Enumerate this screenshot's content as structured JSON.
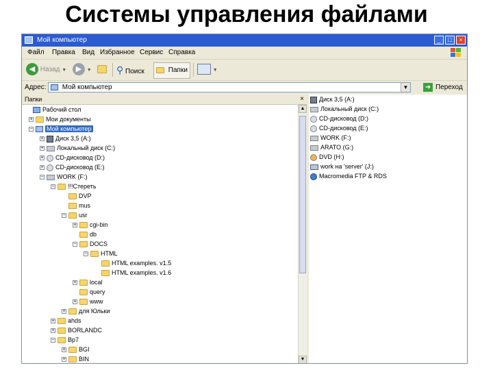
{
  "slide_title": "Системы управления файлами",
  "window": {
    "title": "Мой компьютер",
    "controls": {
      "minimize": "_",
      "maximize": "□",
      "close": "×"
    }
  },
  "menu": [
    "Файл",
    "Правка",
    "Вид",
    "Избранное",
    "Сервис",
    "Справка"
  ],
  "toolbar": {
    "back": "Назад",
    "search": "Поиск",
    "folders": "Папки"
  },
  "address": {
    "label": "Адрес:",
    "value": "Мой компьютер",
    "go": "Переход"
  },
  "folders_pane": {
    "title": "Папки",
    "close": "×"
  },
  "tree": [
    {
      "label": "Рабочий стол",
      "icon": "desktop-icon",
      "expander": "−"
    },
    {
      "label": "Мои документы",
      "icon": "folder-icon",
      "expander": "+"
    },
    {
      "label": "Мой компьютер",
      "icon": "computer-icon",
      "expander": "−",
      "selected": true
    },
    {
      "label": "Диск 3,5 (A:)",
      "icon": "floppy-icon",
      "expander": "+"
    },
    {
      "label": "Локальный диск (C:)",
      "icon": "drive-icon",
      "expander": "+"
    },
    {
      "label": "CD-дисковод (D:)",
      "icon": "cd-icon",
      "expander": "+"
    },
    {
      "label": "CD-дисковод (E:)",
      "icon": "cd-icon",
      "expander": "+"
    },
    {
      "label": "WORK (F:)",
      "icon": "drive-icon",
      "expander": "−"
    },
    {
      "label": "!!!Стереть",
      "icon": "folder-icon",
      "expander": "−"
    },
    {
      "label": "DVP",
      "icon": "folder-icon",
      "expander": ""
    },
    {
      "label": "mus",
      "icon": "folder-icon",
      "expander": ""
    },
    {
      "label": "usr",
      "icon": "folder-icon",
      "expander": "−"
    },
    {
      "label": "cgi-bin",
      "icon": "folder-icon",
      "expander": "+"
    },
    {
      "label": "db",
      "icon": "folder-icon",
      "expander": ""
    },
    {
      "label": "DOCS",
      "icon": "folder-icon",
      "expander": "−"
    },
    {
      "label": "HTML",
      "icon": "folder-icon",
      "expander": "−"
    },
    {
      "label": "HTML examples. v1.5",
      "icon": "folder-icon",
      "expander": ""
    },
    {
      "label": "HTML examples. v1.6",
      "icon": "folder-icon",
      "expander": ""
    },
    {
      "label": "local",
      "icon": "folder-icon",
      "expander": "+"
    },
    {
      "label": "query",
      "icon": "folder-icon",
      "expander": ""
    },
    {
      "label": "www",
      "icon": "folder-icon",
      "expander": "+"
    },
    {
      "label": "для Юльки",
      "icon": "folder-icon",
      "expander": "+"
    },
    {
      "label": "ahds",
      "icon": "folder-icon",
      "expander": "+"
    },
    {
      "label": "BORLANDC",
      "icon": "folder-icon",
      "expander": "+"
    },
    {
      "label": "Bp7",
      "icon": "folder-icon",
      "expander": "−"
    },
    {
      "label": "BGI",
      "icon": "folder-icon",
      "expander": "+"
    },
    {
      "label": "BIN",
      "icon": "folder-icon",
      "expander": "+"
    }
  ],
  "right_items": [
    {
      "label": "Диск 3,5 (A:)",
      "icon": "floppy-icon"
    },
    {
      "label": "Локальный диск (C:)",
      "icon": "drive-icon"
    },
    {
      "label": "CD-дисковод (D:)",
      "icon": "cd-icon"
    },
    {
      "label": "CD-дисковод (E:)",
      "icon": "cd-icon"
    },
    {
      "label": "WORK (F:)",
      "icon": "drive-icon"
    },
    {
      "label": "ARATO (G:)",
      "icon": "drive-icon"
    },
    {
      "label": "DVD (H:)",
      "icon": "cd-icon"
    },
    {
      "label": "work на 'server' (J:)",
      "icon": "network-drive-icon"
    },
    {
      "label": "Macromedia FTP & RDS",
      "icon": "macromedia-icon"
    }
  ]
}
